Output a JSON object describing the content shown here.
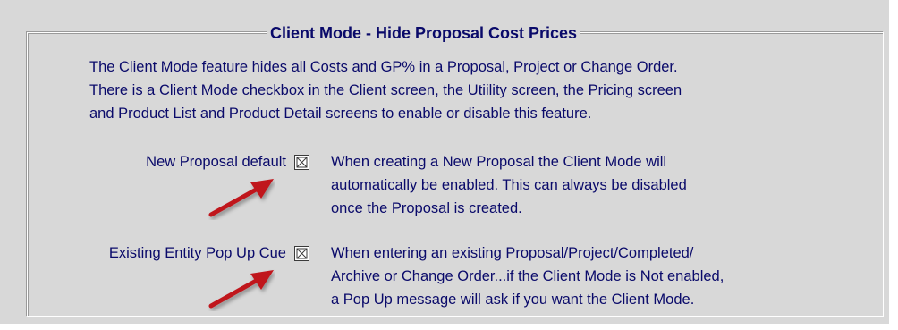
{
  "group": {
    "title": "Client Mode - Hide Proposal Cost Prices"
  },
  "intro_lines": [
    "The Client Mode feature hides all Costs and GP% in a Proposal, Project or Change Order.",
    "There is a Client Mode checkbox in the Client screen, the Utiility screen, the Pricing screen",
    "and Product List and Product Detail screens to enable or disable this feature."
  ],
  "options": [
    {
      "label": "New Proposal default",
      "checked": true,
      "description_lines": [
        "When creating a New Proposal the Client Mode will",
        "automatically be enabled.  This can always be disabled",
        "once the Proposal is created."
      ]
    },
    {
      "label": "Existing Entity Pop Up Cue",
      "checked": true,
      "description_lines": [
        "When entering an existing Proposal/Project/Completed/",
        "Archive or Change Order...if the Client Mode is Not enabled,",
        "a Pop Up message will ask if you want the Client Mode."
      ]
    }
  ],
  "colors": {
    "panel_bg": "#d8d8d8",
    "text": "#0a0a6a",
    "arrow": "#c0141b"
  },
  "icons": {
    "checkbox_mark": "x-mark-icon",
    "annotation": "red-arrow-icon"
  }
}
